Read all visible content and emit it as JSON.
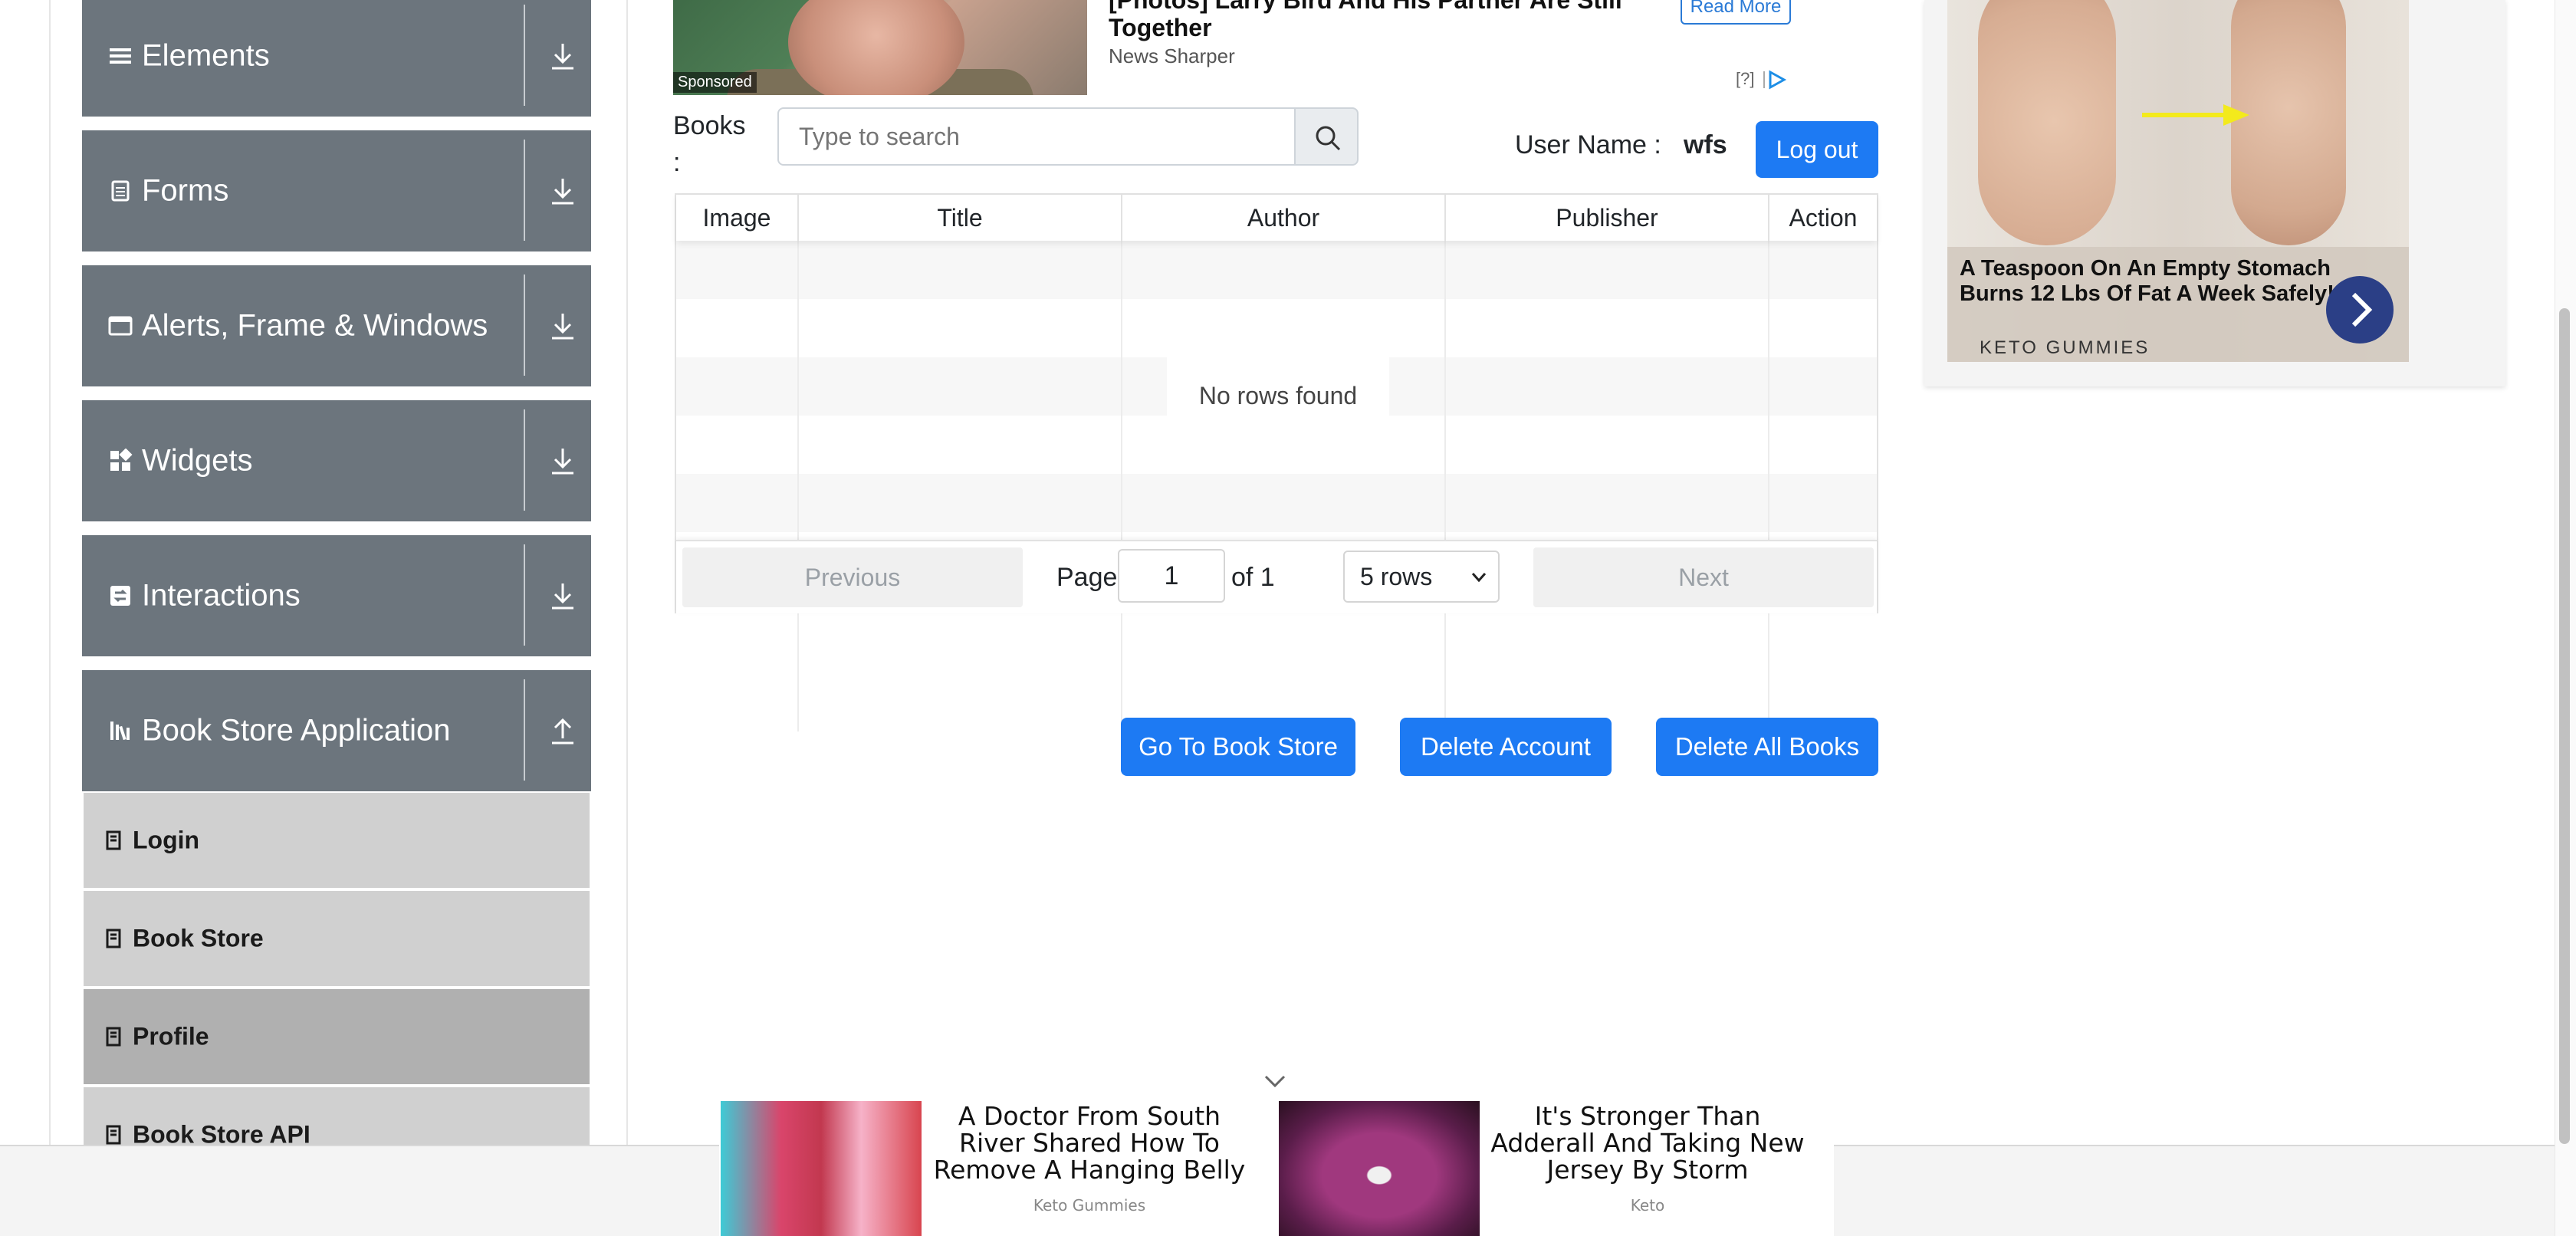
{
  "sidebar": {
    "groups": [
      {
        "label": "Elements",
        "icon": "hamburger-icon",
        "state": "collapsed"
      },
      {
        "label": "Forms",
        "icon": "form-icon",
        "state": "collapsed"
      },
      {
        "label": "Alerts, Frame & Windows",
        "icon": "window-icon",
        "state": "collapsed"
      },
      {
        "label": "Widgets",
        "icon": "widgets-icon",
        "state": "collapsed"
      },
      {
        "label": "Interactions",
        "icon": "interactions-icon",
        "state": "collapsed"
      },
      {
        "label": "Book Store Application",
        "icon": "library-icon",
        "state": "expanded"
      }
    ],
    "subitems": [
      {
        "label": "Login",
        "active": false
      },
      {
        "label": "Book Store",
        "active": false
      },
      {
        "label": "Profile",
        "active": true
      },
      {
        "label": "Book Store API",
        "active": false
      }
    ]
  },
  "top_ad": {
    "title": "[Photos] Larry Bird And His Partner Are Still Together",
    "source": "News Sharper",
    "sponsored": "Sponsored",
    "read_more": "Read More",
    "adchoices": "[?]"
  },
  "books": {
    "label": "Books :",
    "search_placeholder": "Type to search",
    "user_label": "User Name :",
    "user_value": "wfs",
    "logout": "Log out",
    "columns": [
      "Image",
      "Title",
      "Author",
      "Publisher",
      "Action"
    ],
    "empty_message": "No rows found",
    "pagination": {
      "previous": "Previous",
      "page_label": "Page",
      "page_value": "1",
      "of_label": "of 1",
      "rows_option": "5 rows",
      "next": "Next"
    }
  },
  "actions": {
    "go_to_store": "Go To Book Store",
    "delete_account": "Delete Account",
    "delete_all_books": "Delete All Books"
  },
  "right_ad": {
    "text": "A Teaspoon On An Empty Stomach Burns 12 Lbs Of Fat A Week Safely!",
    "brand": "KETO GUMMIES"
  },
  "bottom_ad": {
    "item1_text": "A Doctor From South River Shared How To Remove A Hanging Belly",
    "item1_source": "Keto Gummies",
    "item2_text": "It's Stronger Than Adderall And Taking New Jersey By Storm",
    "item2_source": "Keto"
  },
  "colors": {
    "sidebar_group": "#6c757d",
    "sidebar_sub": "#d0d0d0",
    "sidebar_sub_active": "#b0b0b0",
    "primary_button": "#1d7af3"
  }
}
